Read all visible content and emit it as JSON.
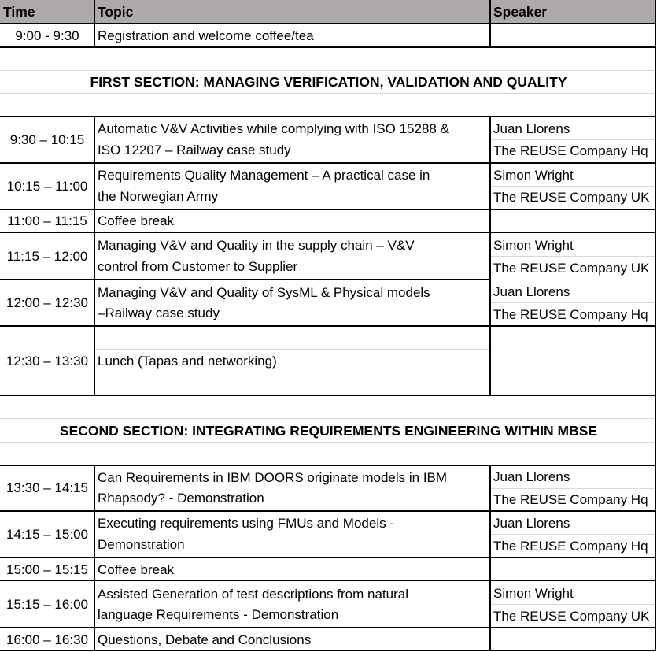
{
  "header": {
    "time": "Time",
    "topic": "Topic",
    "speaker": "Speaker"
  },
  "rows": [
    {
      "time": "9:00 - 9:30",
      "topic_lines": [
        "Registration and welcome coffee/tea"
      ],
      "speaker": null
    },
    {
      "time": "9:30 – 10:15",
      "topic_lines": [
        "Automatic V&V Activities while complying with ISO 15288 &",
        "ISO 12207 – Railway case study"
      ],
      "speaker": {
        "name": "Juan Llorens",
        "org": "The REUSE Company Hq"
      }
    },
    {
      "time": "10:15 – 11:00",
      "topic_lines": [
        "Requirements Quality Management – A practical case in",
        "the Norwegian Army"
      ],
      "speaker": {
        "name": "Simon Wright",
        "org": "The REUSE Company UK"
      }
    },
    {
      "time": "11:00 – 11:15",
      "topic_lines": [
        "Coffee break"
      ],
      "speaker": null
    },
    {
      "time": "11:15 – 12:00",
      "topic_lines": [
        "Managing V&V and Quality in the supply chain – V&V",
        "control from Customer to Supplier"
      ],
      "speaker": {
        "name": "Simon Wright",
        "org": "The REUSE Company UK"
      }
    },
    {
      "time": "12:00 – 12:30",
      "topic_lines": [
        "Managing V&V and Quality of SysML & Physical models",
        "–Railway case study"
      ],
      "speaker": {
        "name": "Juan Llorens",
        "org": "The REUSE Company Hq"
      }
    },
    {
      "time": "12:30 – 13:30",
      "topic_lines": [
        "Lunch (Tapas and networking)"
      ],
      "speaker": null
    },
    {
      "time": "13:30 – 14:15",
      "topic_lines": [
        "Can Requirements in IBM DOORS originate models in IBM",
        "Rhapsody? - Demonstration"
      ],
      "speaker": {
        "name": "Juan Llorens",
        "org": "The REUSE Company Hq"
      }
    },
    {
      "time": "14:15 – 15:00",
      "topic_lines": [
        "Executing requirements using FMUs and Models -",
        "Demonstration"
      ],
      "speaker": {
        "name": "Juan Llorens",
        "org": "The REUSE Company Hq"
      }
    },
    {
      "time": "15:00 – 15:15",
      "topic_lines": [
        "Coffee break"
      ],
      "speaker": null
    },
    {
      "time": "15:15 – 16:00",
      "topic_lines": [
        "Assisted Generation of test descriptions from natural",
        "language Requirements - Demonstration"
      ],
      "speaker": {
        "name": "Simon Wright",
        "org": "The REUSE Company UK"
      }
    },
    {
      "time": "16:00 – 16:30",
      "topic_lines": [
        "Questions, Debate and Conclusions"
      ],
      "speaker": null
    }
  ],
  "sections": [
    {
      "title": "FIRST SECTION: MANAGING VERIFICATION, VALIDATION AND QUALITY"
    },
    {
      "title": "SECOND SECTION: INTEGRATING REQUIREMENTS ENGINEERING WITHIN MBSE"
    }
  ],
  "colors": {
    "header_bg": "#aeaaaa",
    "border": "#000000",
    "gridline": "#d9d9d9"
  }
}
